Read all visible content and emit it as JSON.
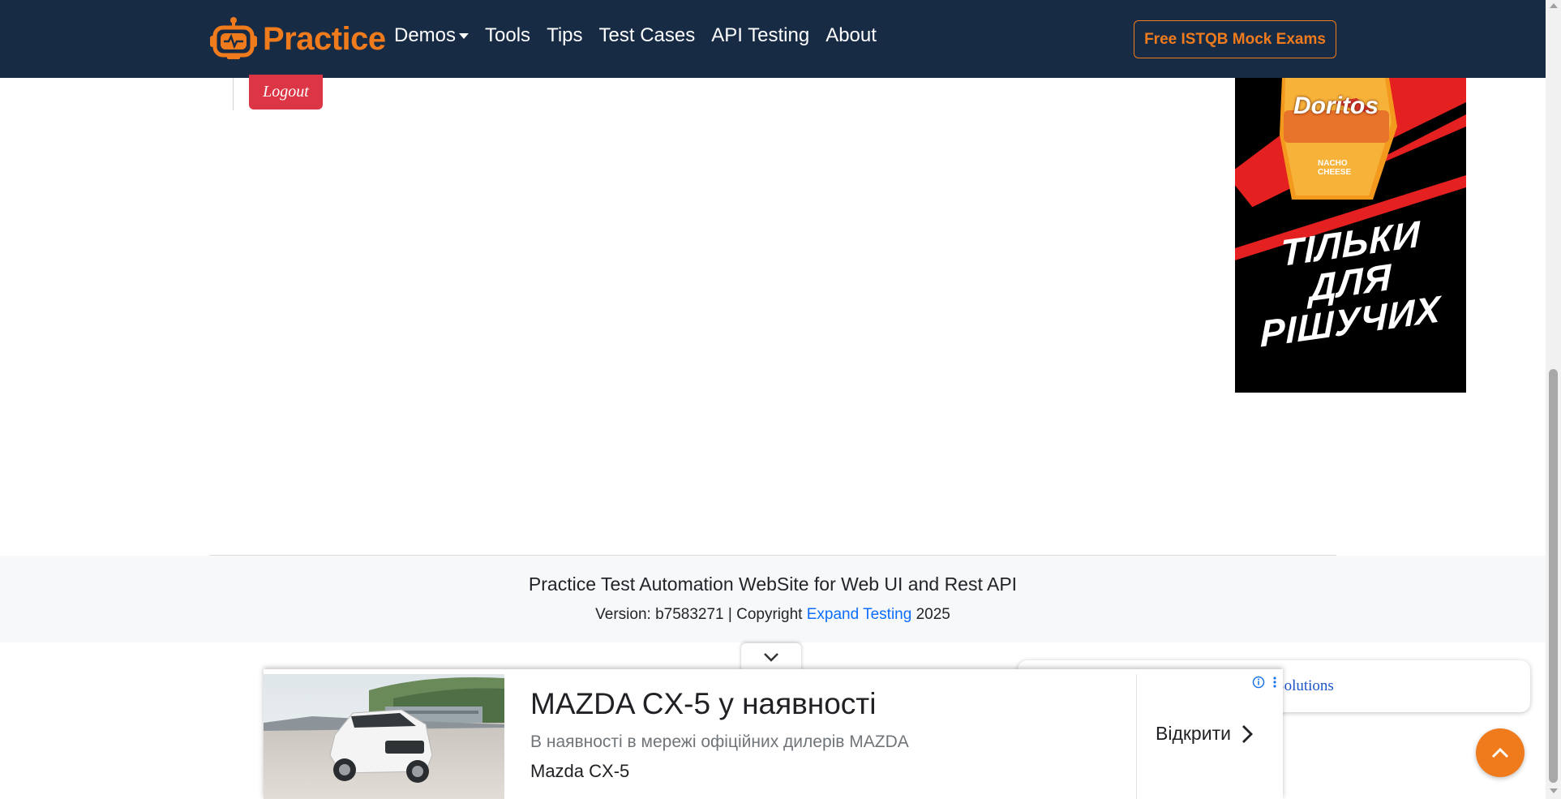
{
  "nav": {
    "brand": "Practice",
    "links": [
      "Demos",
      "Tools",
      "Tips",
      "Test Cases",
      "API Testing",
      "About"
    ],
    "cta": "Free ISTQB Mock Exams",
    "logo_icon": "robot-icon",
    "accent": "#f07b1d",
    "background": "#172b45"
  },
  "content": {
    "logout_label": "Logout",
    "logout_color": "#dc3545"
  },
  "side_ad": {
    "brand": "Doritos",
    "flavor": "NACHO CHEESE",
    "slogan_lines": [
      "ТІЛЬКИ",
      "ДЛЯ",
      "РІШУЧИХ"
    ]
  },
  "footer": {
    "title": "Practice Test Automation WebSite for Web UI and Rest API",
    "version_prefix": "Version: b7583271 | Copyright ",
    "company_link": "Expand Testing",
    "year": " 2025"
  },
  "solutions_card": {
    "text": "Solutions"
  },
  "bottom_ad": {
    "headline": "MAZDA CX-5 у наявності",
    "description": "В наявності в мережі офіційних дилерів MAZDA",
    "brand": "Mazda CX-5",
    "open_label": "Відкрити"
  }
}
